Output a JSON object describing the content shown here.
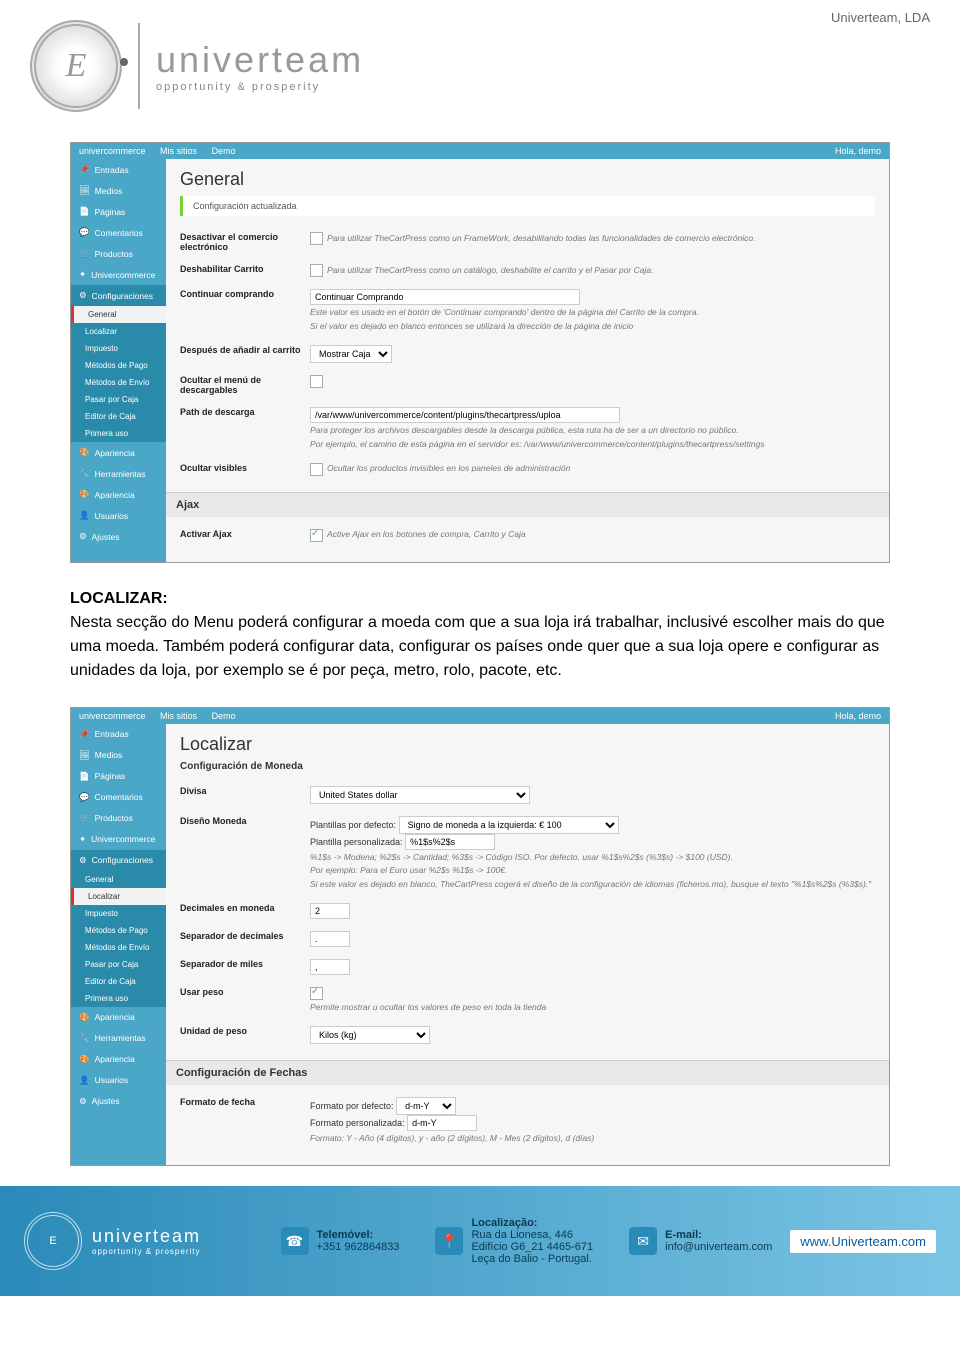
{
  "header": {
    "company": "Univerteam, LDA",
    "brand": "univerteam",
    "tagline": "opportunity & prosperity"
  },
  "screenshot1": {
    "topbar": {
      "logo": "univercommerce",
      "sites": "Mis sitios",
      "demo": "Demo",
      "hello": "Hola, demo"
    },
    "sidebar": {
      "items": [
        "Entradas",
        "Medios",
        "Páginas",
        "Comentarios",
        "Productos",
        "Univercommerce",
        "Configuraciones"
      ],
      "subs": [
        "General",
        "Localizar",
        "Impuesto",
        "Métodos de Pago",
        "Métodos de Envío",
        "Pasar por Caja",
        "Editor de Caja",
        "Primera uso"
      ],
      "items2": [
        "Apariencia",
        "Herramientas",
        "Apariencia",
        "Usuarios",
        "Ajustes"
      ]
    },
    "main": {
      "title": "General",
      "notice": "Configuración actualizada",
      "rows": [
        {
          "label": "Desactivar el comercio electrónico",
          "type": "check",
          "desc": "Para utilizar TheCartPress como un FrameWork, desabilitando todas las funcionalidades de comercio electrónico."
        },
        {
          "label": "Deshabilitar Carrito",
          "type": "check",
          "desc": "Para utilizar TheCartPress como un catálogo, deshabilite el carrito y el Pasar por Caja."
        },
        {
          "label": "Continuar comprando",
          "type": "text",
          "value": "Continuar Comprando",
          "desc": "Este valor es usado en el botón de 'Continuar comprando' dentro de la página del Carrito de la compra.",
          "desc2": "Si el valor es dejado en blanco entonces se utilizará la dirección de la página de inicio"
        },
        {
          "label": "Después de añadir al carrito",
          "type": "select",
          "value": "Mostrar Caja"
        },
        {
          "label": "Ocultar el menú de descargables",
          "type": "check"
        },
        {
          "label": "Path de descarga",
          "type": "text",
          "value": "/var/www/univercommerce/content/plugins/thecartpress/uploa",
          "desc": "Para proteger los archivos descargables desde la descarga pública, esta ruta ha de ser a un directorio no público.",
          "desc2": "Por ejemplo, el camino de esta página en el servidor es: /var/www/univercommerce/content/plugins/thecartpress/settings"
        },
        {
          "label": "Ocultar visibles",
          "type": "check",
          "desc": "Ocultar los productos invisibles en los paneles de administración"
        }
      ],
      "ajax_header": "Ajax",
      "ajax_row": {
        "label": "Activar Ajax",
        "desc": "Active Ajax en los botones de compra, Carrito y Caja"
      }
    }
  },
  "body_text": {
    "heading": "LOCALIZAR:",
    "p": "Nesta secção do Menu poderá configurar a moeda com que a sua loja irá trabalhar, inclusivé escolher mais do que uma moeda. Também poderá configurar data, configurar os países onde quer que a sua loja opere e configurar as unidades da loja, por exemplo se é por peça, metro, rolo, pacote, etc."
  },
  "screenshot2": {
    "topbar": {
      "logo": "univercommerce",
      "sites": "Mis sitios",
      "demo": "Demo",
      "hello": "Hola, demo"
    },
    "sidebar": {
      "items": [
        "Entradas",
        "Medios",
        "Páginas",
        "Comentarios",
        "Productos",
        "Univercommerce",
        "Configuraciones"
      ],
      "subs": [
        "General",
        "Localizar",
        "Impuesto",
        "Métodos de Pago",
        "Métodos de Envío",
        "Pasar por Caja",
        "Editor de Caja",
        "Primera uso"
      ],
      "items2": [
        "Apariencia",
        "Herramientas",
        "Apariencia",
        "Usuarios",
        "Ajustes"
      ]
    },
    "main": {
      "title": "Localizar",
      "section1": "Configuración de Moneda",
      "rows": [
        {
          "label": "Divisa",
          "type": "select",
          "value": "United States dollar"
        },
        {
          "label": "Diseño Moneda",
          "type": "template",
          "pref": "Plantillas por defecto:",
          "prefval": "Signo de moneda a la izquierda: € 100",
          "cust": "Plantilla personalizada:",
          "custval": "%1$s%2$s",
          "desc": "%1$s -> Modena; %2$s -> Cantidad; %3$s -> Código ISO. Por defecto, usar %1$s%2$s (%3$s) -> $100 (USD).",
          "desc2": "Por ejemplo: Para el Euro usar %2$s %1$s -> 100€.",
          "desc3": "Si este valor es dejado en blanco, TheCartPress cogerá el diseño de la configuración de idiomas (ficheros.mo), busque el texto \"%1$s%2$s (%3$s).\""
        },
        {
          "label": "Decimales en moneda",
          "type": "text",
          "value": "2"
        },
        {
          "label": "Separador de decimales",
          "type": "text",
          "value": "."
        },
        {
          "label": "Separador de miles",
          "type": "text",
          "value": ","
        },
        {
          "label": "Usar peso",
          "type": "check",
          "checked": true,
          "desc": "Permite mostrar u ocultar los valores de peso en toda la tienda"
        },
        {
          "label": "Unidad de peso",
          "type": "select",
          "value": "Kilos (kg)"
        }
      ],
      "section2": "Configuración de Fechas",
      "daterow": {
        "label": "Formato de fecha",
        "pref": "Formato por defecto:",
        "prefval": "d-m-Y",
        "cust": "Formato personalizada:",
        "custval": "d-m-Y",
        "desc": "Formato: Y - Año (4 dígitos), y - año (2 dígitos), M - Mes (2 dígitos), d (días)"
      }
    }
  },
  "footer": {
    "brand": "univerteam",
    "tagline": "opportunity & prosperity",
    "tel_label": "Telemóvel:",
    "tel": "+351 962864833",
    "loc_label": "Localização:",
    "loc1": "Rua da Lionesa, 446",
    "loc2": "Edifício G6_21 4465-671",
    "loc3": "Leça do Balio - Portugal.",
    "email_label": "E-mail:",
    "email": "info@univerteam.com",
    "web": "www.Univerteam.com"
  }
}
